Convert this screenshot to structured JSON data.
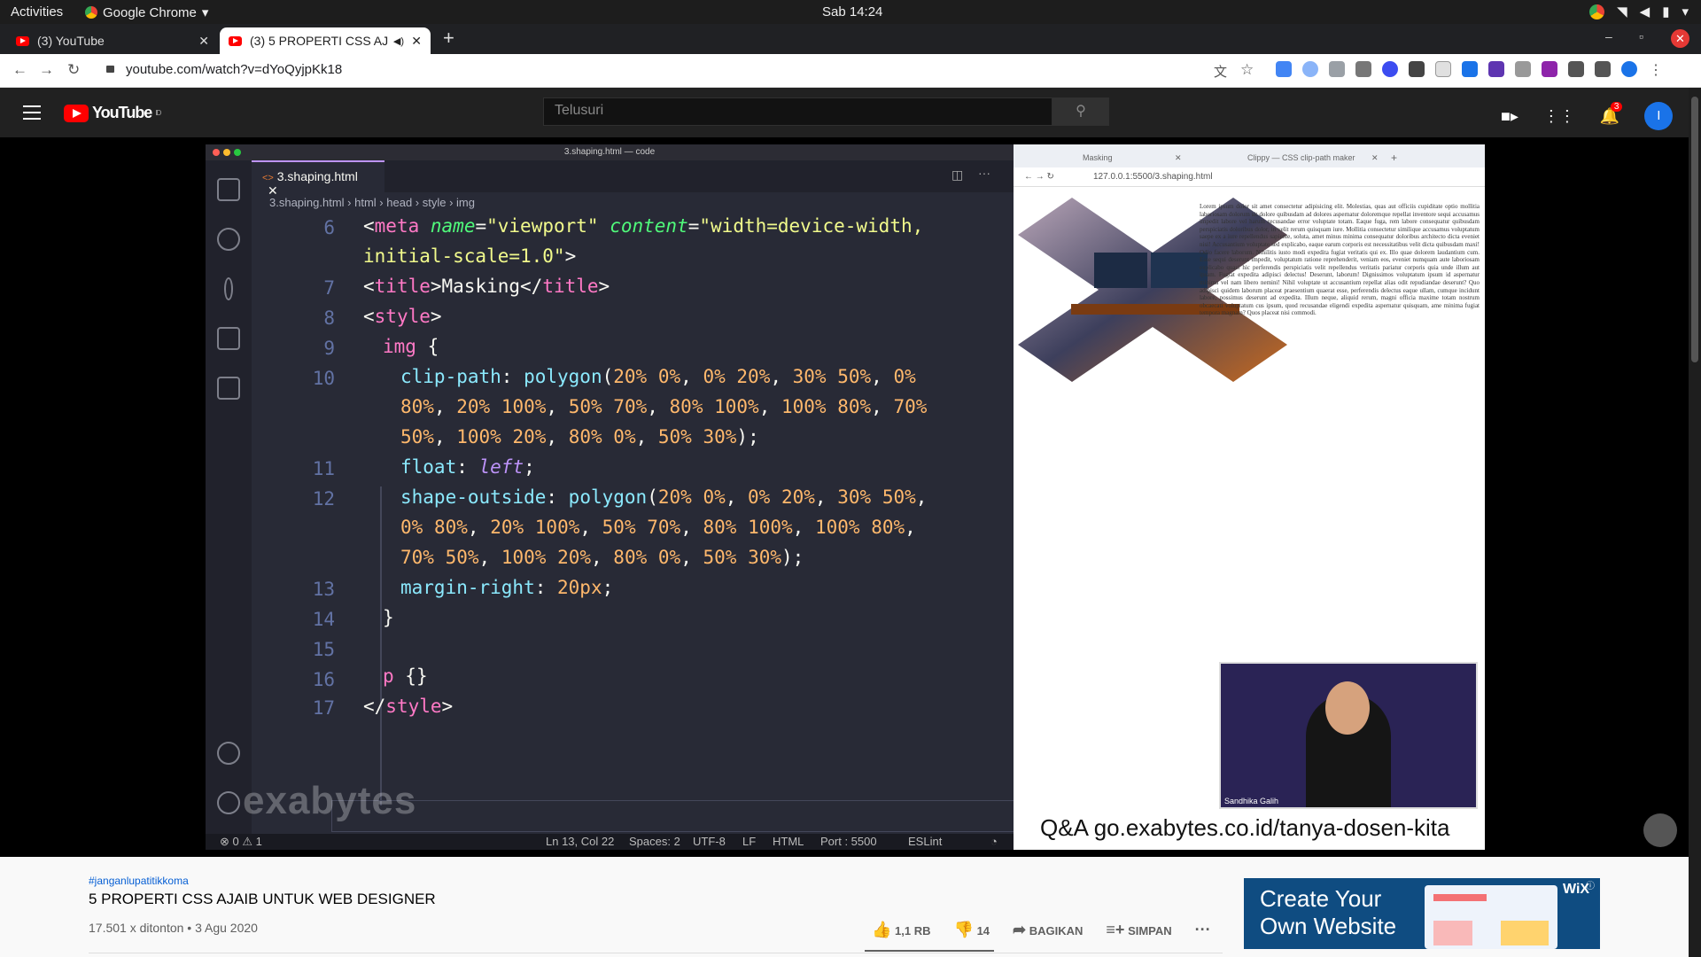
{
  "system": {
    "activities": "Activities",
    "app_name": "Google Chrome",
    "clock": "Sab 14:24"
  },
  "tabs": [
    {
      "title": "(3) YouTube"
    },
    {
      "title": "(3) 5 PROPERTI CSS AJ"
    }
  ],
  "omnibox": {
    "url": "youtube.com/watch?v=dYoQyjpKk18"
  },
  "youtube": {
    "logo_text": "YouTube",
    "logo_region": "ID",
    "search_placeholder": "Telusuri",
    "notification_count": "3",
    "avatar_letter": "I"
  },
  "video": {
    "vscode": {
      "window_title": "3.shaping.html — code",
      "tab": "3.shaping.html",
      "breadcrumbs": [
        "3.shaping.html",
        "html",
        "head",
        "style",
        "img"
      ],
      "status": {
        "problems": "⊗ 0 ⚠ 1",
        "position": "Ln 13, Col 22",
        "spaces": "Spaces: 2",
        "encoding": "UTF-8",
        "eol": "LF",
        "language": "HTML",
        "port": "Port : 5500",
        "linter": "ESLint"
      },
      "line_numbers": [
        "6",
        "7",
        "8",
        "9",
        "10",
        "11",
        "12",
        "13",
        "14",
        "15",
        "16",
        "17"
      ]
    },
    "preview": {
      "tab1": "Masking",
      "tab2": "Clippy — CSS clip-path maker",
      "address": "127.0.0.1:5500/3.shaping.html",
      "lorem": "Lorem ipsum dolor sit amet consectetur adipisicing elit. Molestias, quas aut officiis cupiditate optio mollitia laboriosam dolorum sit dolore quibusdam ad dolores aspernatur doloremque repellat inventore sequi accusamus impedit labore vel harum recusandae error voluptate totam. Eaque fuga, rem labore consequatur quibusdam perspiciatis doloribus dolor, in velit rerum quisquam iure. Mollitia consectetur similique accusamus voluptatum saepe ex a iure repellendus sapiente, soluta, amet minus minima consequatur doloribus architecto dicta eveniet nisi! Accusantium voluptate sed explicabo, eaque earum corporis est necessitatibus velit dicta quibusdam maxi! Odio facere laborum. Nihilitis iusto modi expedita fugiat veritatis qui ex. Illo quae dolorem laudantium cum. Esse sequi deserunt impedit, voluptatum ratione reprehenderit, veniam eos, eveniet numquam aute laboriosam explicabo quasi hic perferendis perspiciatis velit repellendus veritatis pariatur corporis quia unde illum aut ipsam. Fugiat expedita adipisci delectus! Deserunt, laborum! Dignissimos voluptatum ipsum id aspernatur minima vel nam libero nemini! Nihil voluptate ut accusantium repellat alias odit repudiandae deserunt? Quo adipisci quidem laborum placeat praesentium quaerat esse, perferendis delectus eaque ullam, cumque incidunt labore, possimus deserunt ad expedita. Illum neque, aliquid rerum, magni officia maxime totam nostrum obcaecati voluptatum cus ipsum, quod recusandae eligendi expedita aspernatur quisquam, ame minima fugiat tempora magnam? Quos placeat nisi commodi.",
      "qa": "Q&A go.exabytes.co.id/tanya-dosen-kita",
      "presenter": "Sandhika Galih"
    },
    "watermark": "exabytes"
  },
  "info": {
    "hashtag": "#janganlupatitikkoma",
    "title": "5 PROPERTI CSS AJAIB UNTUK WEB DESIGNER",
    "views": "17.501 x ditonton • 3 Agu 2020",
    "likes": "1,1 RB",
    "dislikes": "14",
    "share": "BAGIKAN",
    "save": "SIMPAN"
  },
  "ad": {
    "line1": "Create Your",
    "line2": "Own Website",
    "brand": "WiX"
  },
  "colors": {
    "accent": "#bd93f9",
    "yt_red": "#ff0000",
    "tag": "#ff79c6",
    "attr": "#50fa7b",
    "string": "#f1fa8c",
    "prop": "#8be9fd",
    "number": "#ffb86c"
  }
}
